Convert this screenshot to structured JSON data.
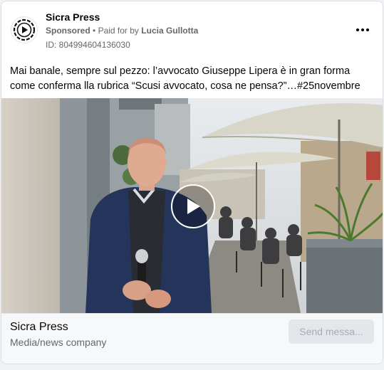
{
  "post": {
    "page_name": "Sicra Press",
    "sponsored_label": "Sponsored",
    "separator": "•",
    "paid_for_prefix": "Paid for by",
    "payer": "Lucia Gullotta",
    "ad_id": "ID: 804994604136030",
    "more_icon": "more-horizontal-icon",
    "text": "Mai banale, sempre sul pezzo: l’avvocato Giuseppe Lipera è in gran forma come conferma lla rubrica “Scusi avvocato, cosa ne pensa?”…#25novembre"
  },
  "media": {
    "type": "video",
    "play_icon": "play-icon"
  },
  "footer": {
    "title": "Sicra Press",
    "subtitle": "Media/news company",
    "cta_label": "Send messa..."
  },
  "colors": {
    "text_primary": "#050505",
    "text_secondary": "#65676b",
    "cta_bg": "#e4e6eb",
    "cta_text": "#a8abaf"
  }
}
